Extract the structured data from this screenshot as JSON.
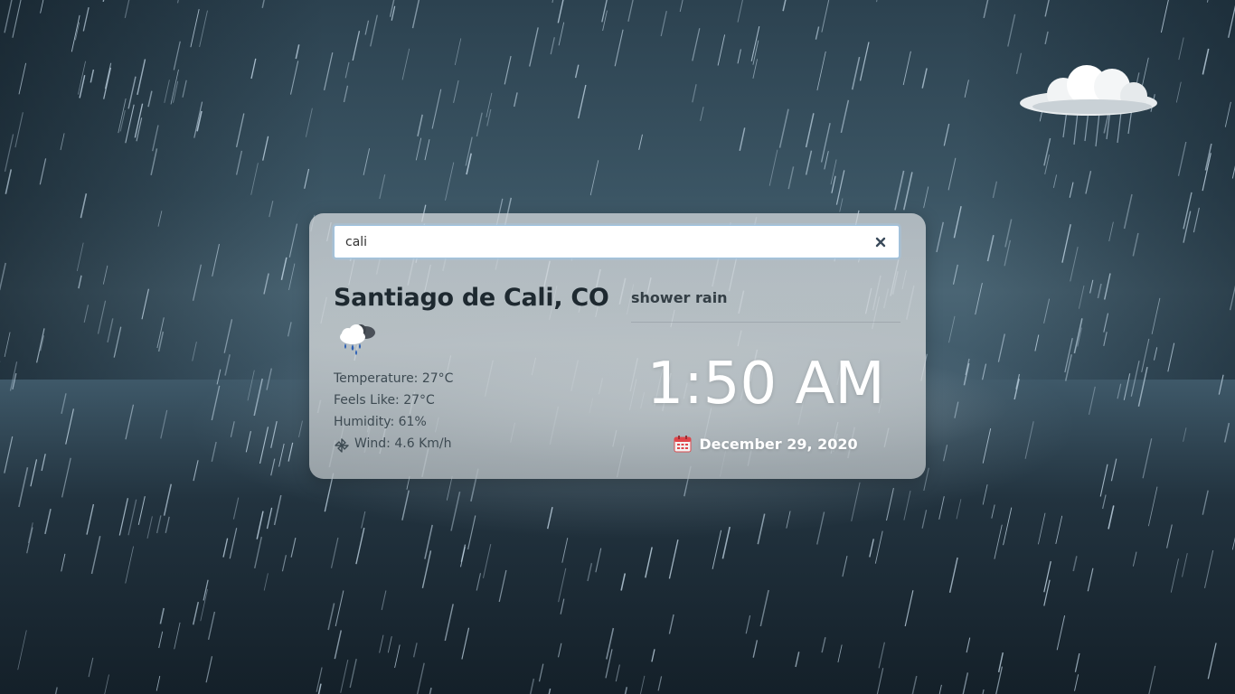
{
  "search": {
    "value": "cali",
    "clear_icon": "close-icon"
  },
  "weather": {
    "city": "Santiago de Cali, CO",
    "icon": "cloud-rain-icon",
    "description": "shower rain",
    "temperature": "Temperature: 27°C",
    "feels_like": "Feels Like: 27°C",
    "humidity": "Humidity: 61%",
    "wind": "Wind: 4.6 Km/h",
    "wind_icon": "wind-pinwheel-icon"
  },
  "clock": {
    "time": "1:50 AM",
    "date": "December 29, 2020",
    "date_icon": "calendar-icon"
  },
  "background": {
    "theme": "rain",
    "corner_icon": "rain-cloud-icon"
  },
  "colors": {
    "card_bg": "#d2d6d9",
    "time_text": "#ffffff",
    "calendar_accent": "#e0454a",
    "input_border": "#9ec3e0"
  }
}
